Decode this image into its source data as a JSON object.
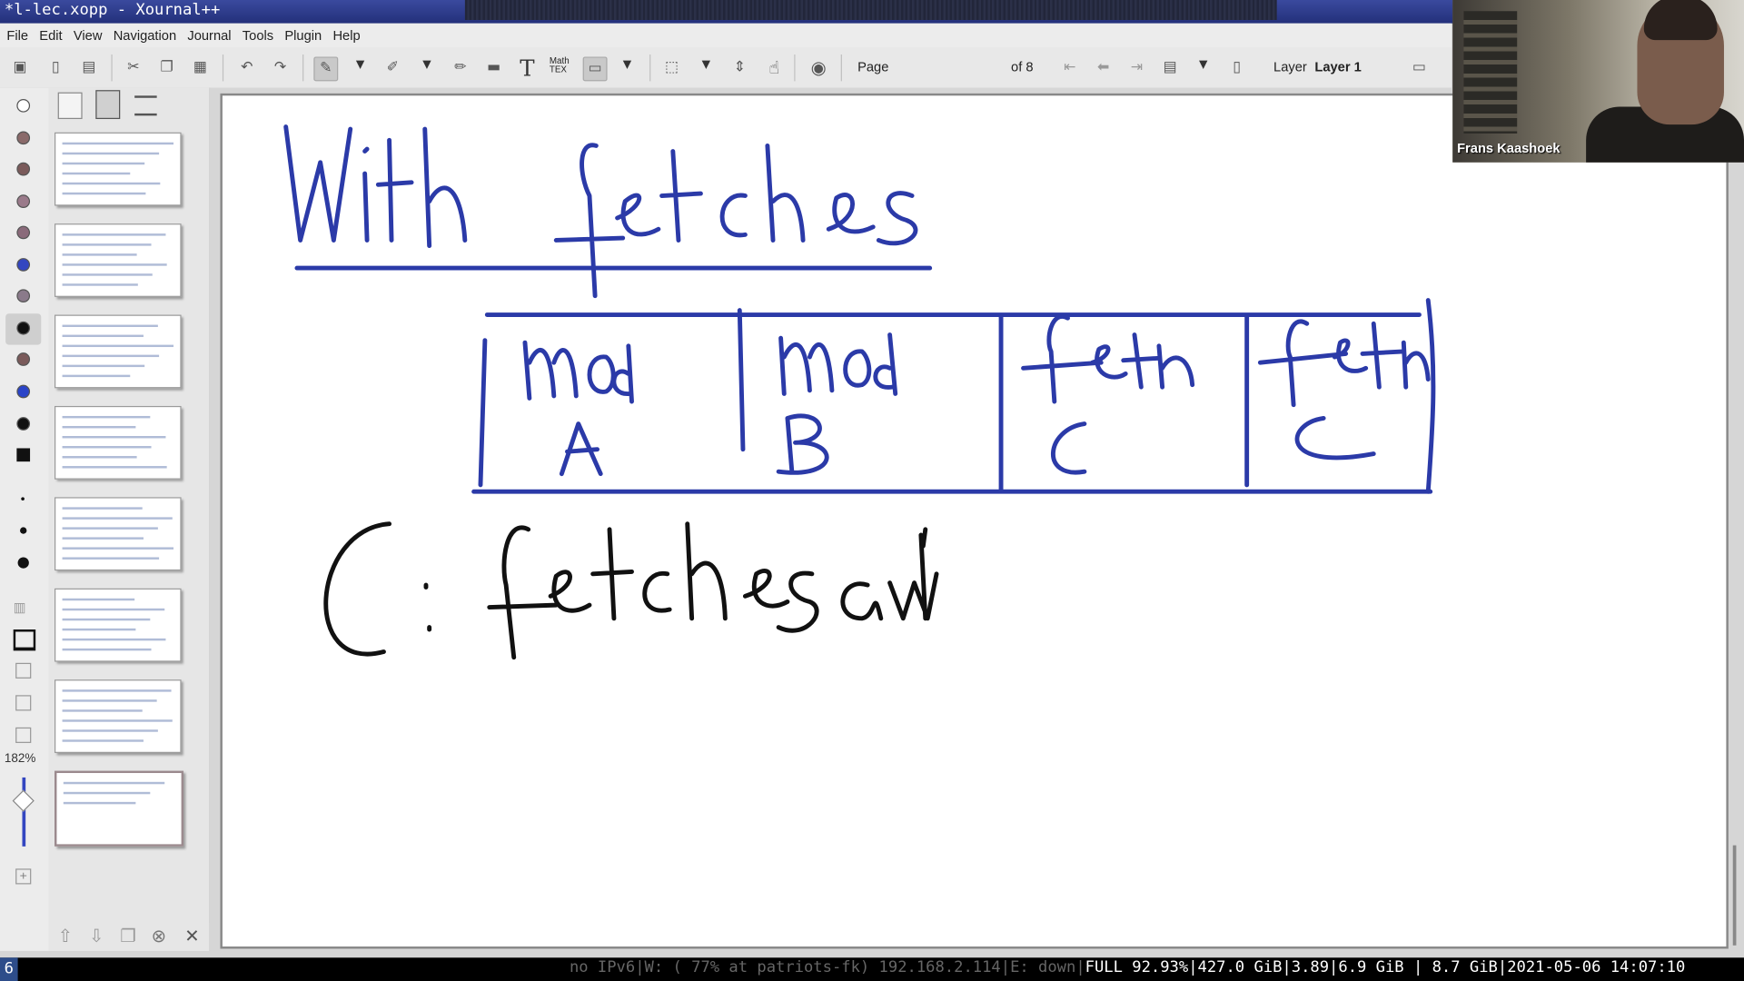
{
  "window": {
    "title": "*l-lec.xopp - Xournal++"
  },
  "menu": [
    "File",
    "Edit",
    "View",
    "Navigation",
    "Journal",
    "Tools",
    "Plugin",
    "Help"
  ],
  "toolbar": {
    "page_label": "Page",
    "page_value": "8",
    "page_of": "of 8",
    "layer_label": "Layer",
    "layer_value": "Layer 1",
    "math_label": "Math TEX",
    "text_tool_glyph": "T"
  },
  "zoom": "182%",
  "webcam": {
    "name": "Frans Kaashoek"
  },
  "pages_total": 8,
  "current_page": 8,
  "handwriting": {
    "heading": "With fetches",
    "cells": [
      {
        "top": "mod",
        "bottom": "A"
      },
      {
        "top": "mod",
        "bottom": "B"
      },
      {
        "top": "fetch",
        "bottom": "C"
      },
      {
        "top": "fetch",
        "bottom": "C"
      }
    ],
    "note": "C: fetches awl'"
  },
  "colors": {
    "ink_blue": "#2b3aa8",
    "ink_black": "#111111",
    "title_bar": "#2b3a8c"
  },
  "statusbar": {
    "workspace": "6",
    "ipv6": "no IPv6",
    "wifi": "W: ( 77% at patriots-fk) 192.168.2.114",
    "eth": "E: down",
    "battery": "FULL 92.93%",
    "disk": "427.0 GiB",
    "load": "3.89",
    "mem_used": "6.9 GiB",
    "mem_total": "8.7 GiB",
    "datetime": "2021-05-06 14:07:10"
  }
}
